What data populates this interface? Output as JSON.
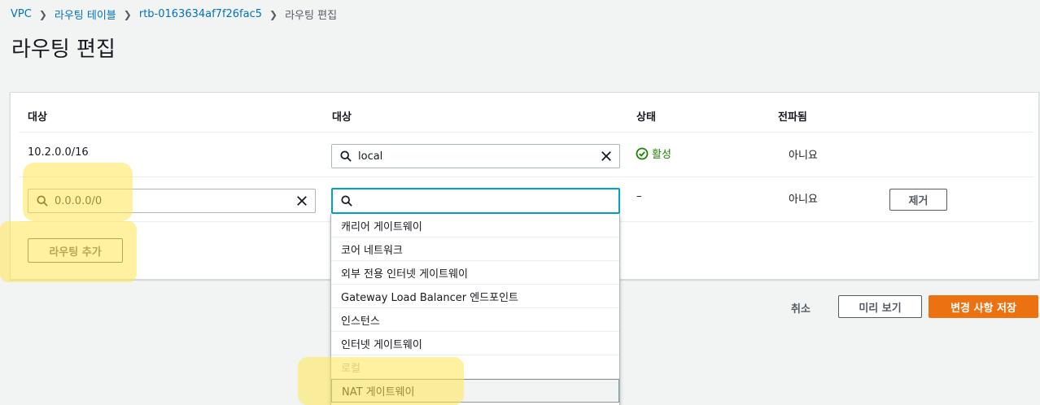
{
  "breadcrumb": {
    "items": [
      "VPC",
      "라우팅 테이블",
      "rtb-0163634af7f26fac5"
    ],
    "current": "라우팅 편집"
  },
  "page": {
    "title": "라우팅 편집"
  },
  "table": {
    "headers": [
      "대상",
      "대상",
      "상태",
      "전파됨"
    ],
    "rows": [
      {
        "destination": "10.2.0.0/16",
        "target_value": "local",
        "status": "활성",
        "propagated": "아니요"
      },
      {
        "destination_value": "0.0.0.0/0",
        "target_value": "",
        "status": "–",
        "propagated": "아니요",
        "remove_label": "제거"
      }
    ]
  },
  "add_route_label": "라우팅 추가",
  "dropdown": {
    "options": [
      "캐리어 게이트웨이",
      "코어 네트워크",
      "외부 전용 인터넷 게이트웨이",
      "Gateway Load Balancer 엔드포인트",
      "인스턴스",
      "인터넷 게이트웨이",
      "로컬",
      "NAT 게이트웨이"
    ]
  },
  "footer": {
    "cancel_label": "취소",
    "preview_label": "미리 보기",
    "save_label": "변경 사항 저장"
  },
  "colors": {
    "link": "#0073bb",
    "status_active": "#1d8102",
    "primary": "#ec7211",
    "focus": "#00a1c9"
  }
}
